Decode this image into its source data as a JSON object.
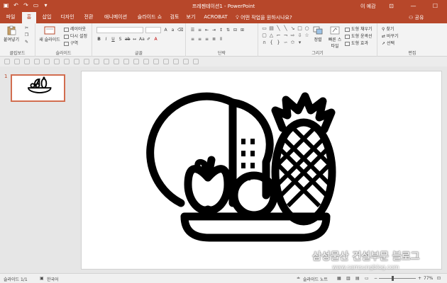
{
  "titlebar": {
    "title": "프레젠테이션1 - PowerPoint",
    "user": "이 예감",
    "qat_icons": [
      "save-icon",
      "undo-icon",
      "redo-icon",
      "slideshow-icon",
      "customize-icon"
    ]
  },
  "tabs": [
    {
      "label": "파일",
      "active": false
    },
    {
      "label": "홈",
      "active": true
    },
    {
      "label": "삽입",
      "active": false
    },
    {
      "label": "디자인",
      "active": false
    },
    {
      "label": "전환",
      "active": false
    },
    {
      "label": "애니메이션",
      "active": false
    },
    {
      "label": "슬라이드 쇼",
      "active": false
    },
    {
      "label": "검토",
      "active": false
    },
    {
      "label": "보기",
      "active": false
    },
    {
      "label": "ACROBAT",
      "active": false
    }
  ],
  "tell_me": "어떤 작업을 원하시나요?",
  "share": "공유",
  "ribbon": {
    "clipboard": {
      "label": "클립보드",
      "paste": "붙여넣기"
    },
    "slides": {
      "label": "슬라이드",
      "new_slide": "새 슬라이드",
      "layout": "레이아웃",
      "reset": "다시 설정",
      "section": "구역"
    },
    "font": {
      "label": "글꼴"
    },
    "paragraph": {
      "label": "단락"
    },
    "drawing": {
      "label": "그리기",
      "arrange": "정렬",
      "quick_styles": "빠른 스타일",
      "fill": "도형 채우기",
      "outline": "도형 윤곽선",
      "effects": "도형 효과"
    },
    "editing": {
      "label": "편집",
      "find": "찾기",
      "replace": "바꾸기",
      "select": "선택"
    }
  },
  "thumbnail": {
    "slide_number": "1"
  },
  "slide": {
    "image_icon": "fruit-basket-icon"
  },
  "watermark": {
    "main": "삼성물산 건설부문 블로그",
    "sub": "www.samsungblog.com"
  },
  "statusbar": {
    "slide_info": "슬라이드 1/1",
    "language": "한국어",
    "notes": "슬라이드 노트",
    "zoom": "77%",
    "zoom_fraction": 0.77
  },
  "colors": {
    "accent": "#b7472a",
    "ribbon_bg": "#f3f3f3",
    "selection": "#d26d4f"
  }
}
